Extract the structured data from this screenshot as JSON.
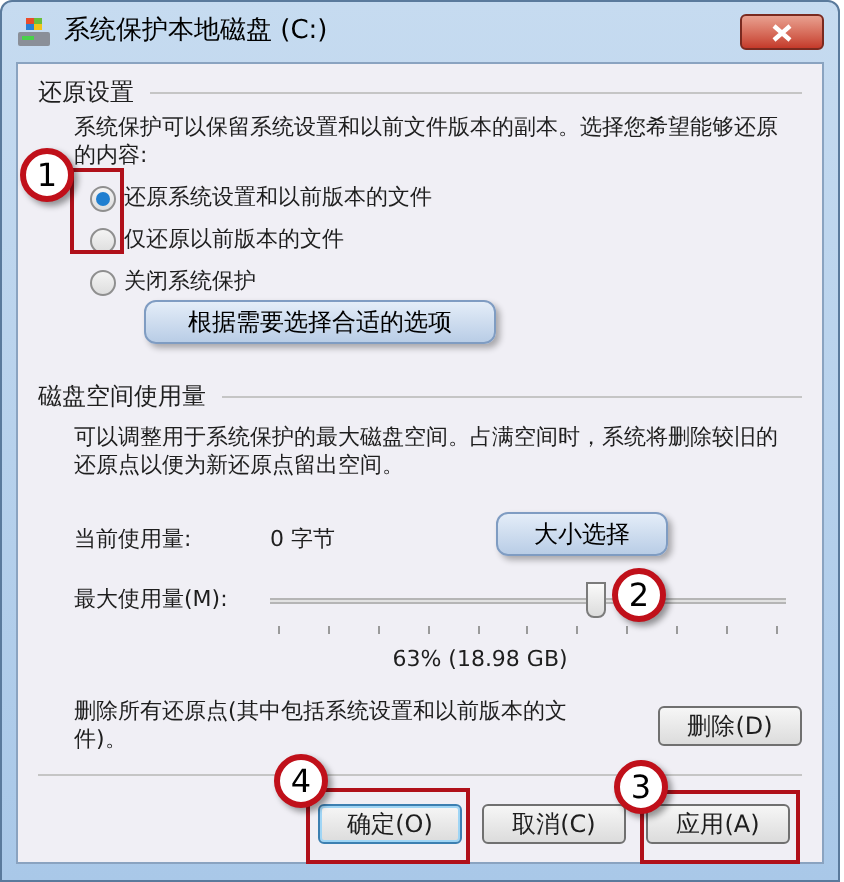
{
  "window": {
    "title": "系统保护本地磁盘 (C:)"
  },
  "restore_settings": {
    "heading": "还原设置",
    "description": "系统保护可以保留系统设置和以前文件版本的副本。选择您希望能够还原的内容:",
    "options": [
      {
        "label": "还原系统设置和以前版本的文件",
        "selected": true
      },
      {
        "label": "仅还原以前版本的文件",
        "selected": false
      },
      {
        "label": "关闭系统保护",
        "selected": false
      }
    ]
  },
  "disk_usage": {
    "heading": "磁盘空间使用量",
    "description": "可以调整用于系统保护的最大磁盘空间。占满空间时，系统将删除较旧的还原点以便为新还原点留出空间。",
    "current_label": "当前使用量:",
    "current_value": "0 字节",
    "max_label": "最大使用量(M):",
    "slider": {
      "level": 0.63
    },
    "reading": "63% (18.98 GB)",
    "delete_text": "删除所有还原点(其中包括系统设置和以前版本的文件)。",
    "delete_button": "删除(D)"
  },
  "buttons": [
    {
      "label": "确定(O)",
      "default": true
    },
    {
      "label": "取消(C)",
      "default": false
    },
    {
      "label": "应用(A)",
      "default": false
    }
  ],
  "annotations": [
    {
      "kind": "number",
      "text": "1"
    },
    {
      "kind": "callout",
      "text": "根据需要选择合适的选项"
    },
    {
      "kind": "callout",
      "text": "大小选择"
    },
    {
      "kind": "number",
      "text": "2"
    },
    {
      "kind": "number",
      "text": "3"
    },
    {
      "kind": "number",
      "text": "4"
    }
  ]
}
